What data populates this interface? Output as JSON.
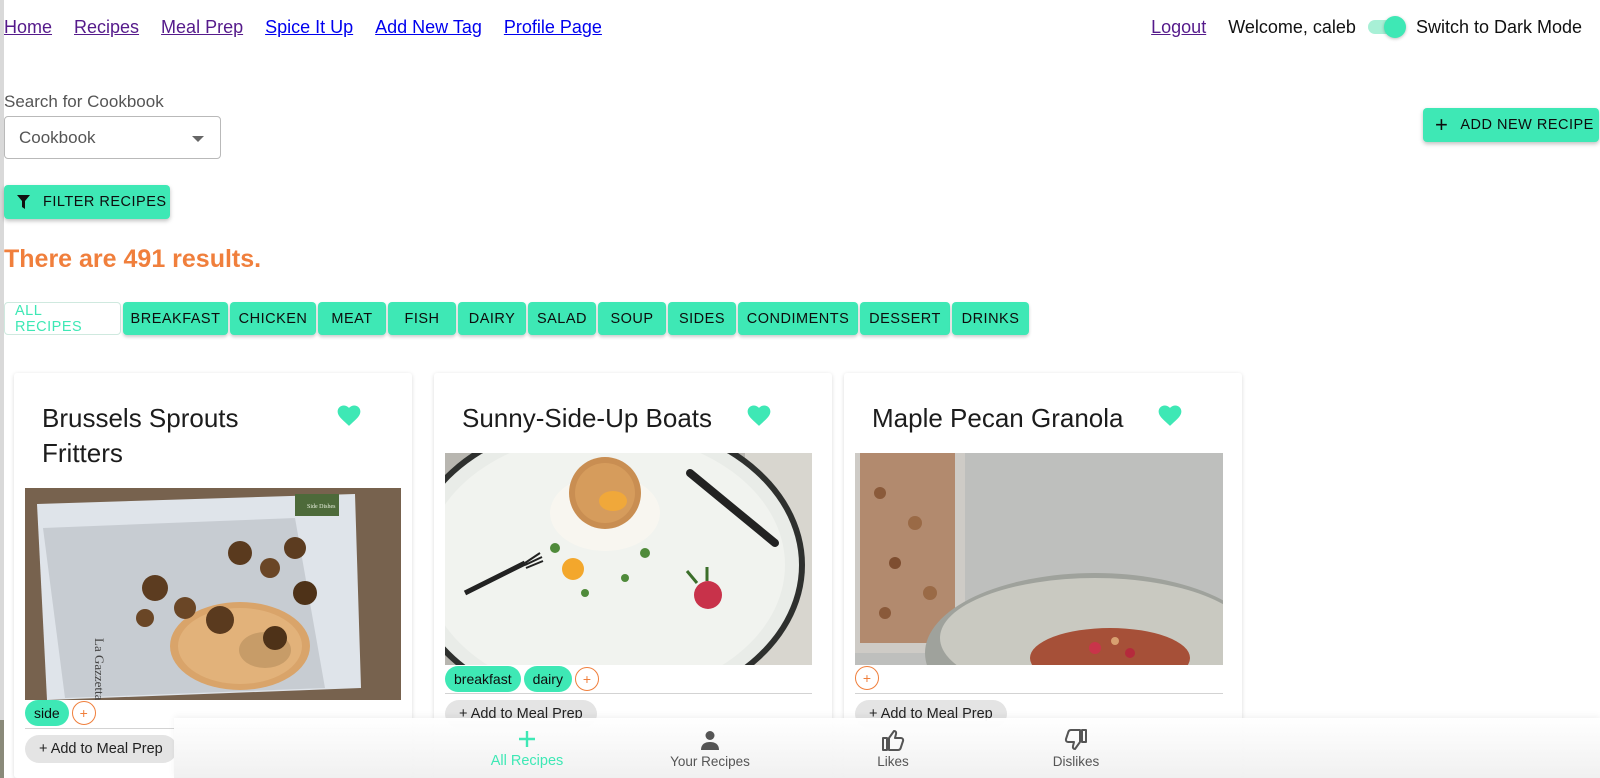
{
  "nav": {
    "links": [
      "Home",
      "Recipes",
      "Meal Prep",
      "Spice It Up",
      "Add New Tag",
      "Profile Page"
    ],
    "logout": "Logout",
    "welcome": "Welcome, caleb",
    "dark_mode_label": "Switch to Dark Mode",
    "dark_mode_on": true
  },
  "search": {
    "label": "Search for Cookbook",
    "value": "Cookbook"
  },
  "buttons": {
    "add_recipe": "ADD NEW RECIPE",
    "filter": "FILTER RECIPES"
  },
  "results_text": "There are 491 results.",
  "categories": [
    "ALL RECIPES",
    "BREAKFAST",
    "CHICKEN",
    "MEAT",
    "FISH",
    "DAIRY",
    "SALAD",
    "SOUP",
    "SIDES",
    "CONDIMENTS",
    "DESSERT",
    "DRINKS"
  ],
  "selected_category": "ALL RECIPES",
  "recipes": [
    {
      "title": "Brussels Sprouts Fritters",
      "tags": [
        "side"
      ],
      "meal_prep": "+ Add to Meal Prep",
      "liked": true,
      "img_text_1": "Side Dishes",
      "img_text_2": "La Gazzetta"
    },
    {
      "title": "Sunny-Side-Up Boats",
      "tags": [
        "breakfast",
        "dairy"
      ],
      "meal_prep": "+ Add to Meal Prep",
      "liked": true
    },
    {
      "title": "Maple Pecan Granola",
      "tags": [],
      "meal_prep": "+ Add to Meal Prep",
      "liked": true
    }
  ],
  "tag_add_symbol": "+",
  "bottom_nav": [
    {
      "label": "All Recipes",
      "icon": "plus-icon",
      "active": true
    },
    {
      "label": "Your Recipes",
      "icon": "person-icon",
      "active": false
    },
    {
      "label": "Likes",
      "icon": "thumb-up-icon",
      "active": false
    },
    {
      "label": "Dislikes",
      "icon": "thumb-down-icon",
      "active": false
    }
  ],
  "colors": {
    "accent": "#3ee8b5",
    "results": "#f07f3c",
    "visited_link": "#551a8b",
    "link": "#0000ee"
  }
}
